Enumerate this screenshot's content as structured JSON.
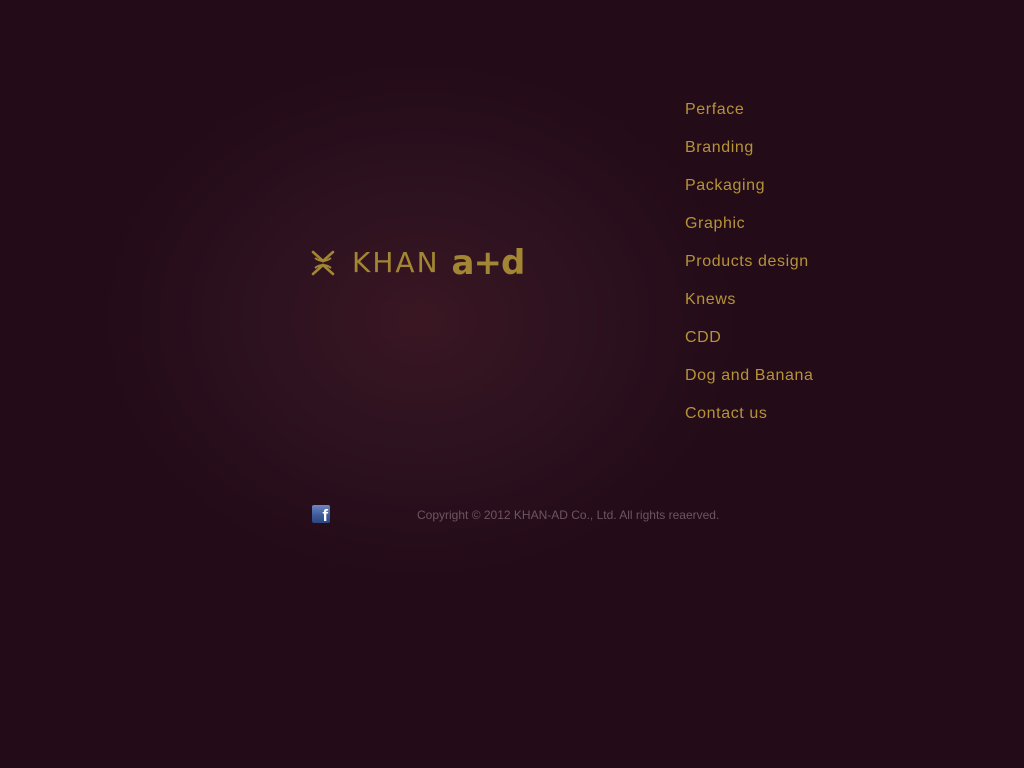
{
  "logo": {
    "mark_icon": "khan-emblem-icon",
    "name": "KHAN",
    "suffix": "a+d"
  },
  "nav": {
    "items": [
      {
        "label": "Perface"
      },
      {
        "label": "Branding"
      },
      {
        "label": "Packaging"
      },
      {
        "label": "Graphic"
      },
      {
        "label": "Products design"
      },
      {
        "label": "Knews"
      },
      {
        "label": "CDD"
      },
      {
        "label": "Dog and Banana"
      },
      {
        "label": "Contact us"
      }
    ]
  },
  "footer": {
    "social_icon": "facebook-icon",
    "facebook_glyph": "f",
    "copyright": "Copyright © 2012 KHAN-AD Co., Ltd. All rights reaerved."
  },
  "colors": {
    "background": "#230b17",
    "accent_gold": "#b6933a",
    "copyright_text": "#6e5560",
    "facebook_blue": "#3b5998"
  }
}
